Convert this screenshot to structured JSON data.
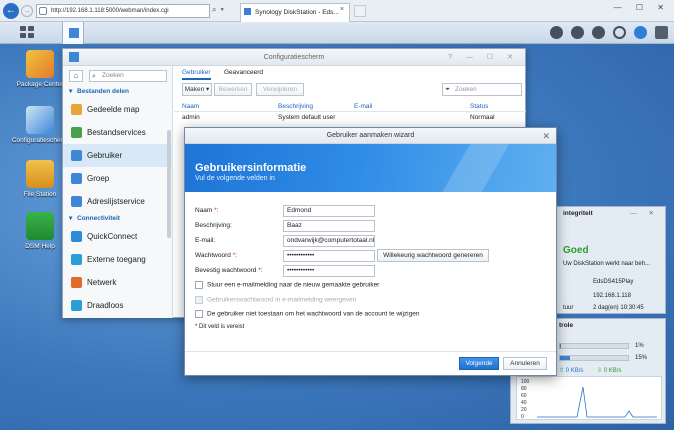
{
  "browser": {
    "url": "http://192.168.1.118:5000/webman/index.cgi",
    "tab_title": "Synology DiskStation - Eds...",
    "tab_close": "×",
    "win_controls": "— ☐ ✕",
    "star_controls": "⌂ ☆ ⚙"
  },
  "desktop": {
    "icons": [
      {
        "label": "Package Center"
      },
      {
        "label": "Configuratiescherm"
      },
      {
        "label": "File Station"
      },
      {
        "label": "DSM Help"
      }
    ]
  },
  "config": {
    "title": "Configuratiescherm",
    "controls": "? — ☐ ✕",
    "search_placeholder": "Zoeken",
    "sidebar": [
      {
        "type": "section",
        "label": "Bestanden delen"
      },
      {
        "type": "item",
        "label": "Gedeelde map",
        "color": "#e8a43a"
      },
      {
        "type": "item",
        "label": "Bestandservices",
        "color": "#4aa04a"
      },
      {
        "type": "item",
        "label": "Gebruiker",
        "color": "#3f86d6",
        "active": true
      },
      {
        "type": "item",
        "label": "Groep",
        "color": "#3f86d6"
      },
      {
        "type": "item",
        "label": "Adreslijstservice",
        "color": "#3f86d6"
      },
      {
        "type": "section",
        "label": "Connectiviteit"
      },
      {
        "type": "item",
        "label": "QuickConnect",
        "color": "#2f8ad8"
      },
      {
        "type": "item",
        "label": "Externe toegang",
        "color": "#2a9ed6"
      },
      {
        "type": "item",
        "label": "Netwerk",
        "color": "#e06a2a"
      },
      {
        "type": "item",
        "label": "Draadloos",
        "color": "#2a9ed6"
      }
    ],
    "tabs": [
      "Gebruiker",
      "Geavanceerd"
    ],
    "toolbar": {
      "create": "Maken",
      "edit": "Bewerken",
      "delete": "Verwijderen"
    },
    "filter_placeholder": "Zoeken",
    "columns": [
      "Naam",
      "Beschrijving",
      "E-mail",
      "Status"
    ],
    "rows": [
      {
        "name": "admin",
        "description": "System default user",
        "email": "",
        "status": "Normaal"
      }
    ]
  },
  "wizard": {
    "title": "Gebruiker aanmaken wizard",
    "close": "✕",
    "heading": "Gebruikersinformatie",
    "subheading": "Vul de volgende velden in",
    "fields": [
      {
        "label": "Naam",
        "required": true,
        "value": "Edmond"
      },
      {
        "label": "Beschrijving:",
        "required": false,
        "value": "Baaz"
      },
      {
        "label": "E-mail:",
        "required": false,
        "value": "ondvarwijk@computertotaal.nl"
      },
      {
        "label": "Wachtwoord",
        "required": true,
        "value": "••••••••••••"
      },
      {
        "label": "Bevestig wachtwoord",
        "required": true,
        "value": "••••••••••••"
      }
    ],
    "generate_button": "Willekeurig wachtwoord genereren",
    "checkboxes": [
      {
        "label": "Stuur een e-mailmelding naar de nieuw gemaakte gebruiker",
        "disabled": false
      },
      {
        "label": "Gebruikerswachtwoord in e-mailmelding weergeven",
        "disabled": true
      },
      {
        "label": "De gebruiker niet toestaan om het wachtwoord van de account te wijzigen",
        "disabled": false
      }
    ],
    "required_note": "* Dit veld is vereist",
    "next_button": "Volgende",
    "cancel_button": "Annuleren"
  },
  "widgets": {
    "health": {
      "title": "integriteit",
      "status": "Goed",
      "message": "Uw DiskStation werkt naar beh...",
      "server_name": "EdsDS415Play",
      "ip": "192.168.1.118",
      "uptime": "2 dag(en) 10:30:45",
      "uptime_label": "tuur"
    },
    "resource": {
      "title": "trole",
      "cpu_label": "1%",
      "cpu": 0.01,
      "ram_label": "15%",
      "ram": 0.15,
      "upload": "0 KB/s",
      "download": "0 KB/s",
      "graph_ticks": [
        "100",
        "80",
        "60",
        "40",
        "20",
        "0"
      ]
    }
  }
}
